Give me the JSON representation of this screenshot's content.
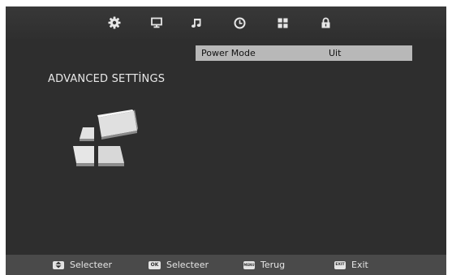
{
  "top_menu": {
    "icons": [
      {
        "name": "settings-gear-icon",
        "active": true
      },
      {
        "name": "monitor-icon",
        "active": false
      },
      {
        "name": "music-note-icon",
        "active": false
      },
      {
        "name": "clock-icon",
        "active": false
      },
      {
        "name": "apps-grid-icon",
        "active": false
      },
      {
        "name": "lock-icon",
        "active": false
      }
    ]
  },
  "section": {
    "title": "ADVANCED SETTİNGS",
    "illustration": "advanced-settings-icon"
  },
  "menu_items": [
    {
      "label": "Power Mode",
      "value": "Uit",
      "selected": true
    }
  ],
  "footer": {
    "hints": [
      {
        "key_icon": "up-down-key-icon",
        "key_text": "",
        "label": "Selecteer"
      },
      {
        "key_icon": "ok-key-icon",
        "key_text": "OK",
        "label": "Selecteer"
      },
      {
        "key_icon": "menu-key-icon",
        "key_text": "MENU",
        "label": "Terug"
      },
      {
        "key_icon": "exit-key-icon",
        "key_text": "EXIT",
        "label": "Exit"
      }
    ]
  },
  "colors": {
    "background": "#2e2e2e",
    "highlight_row": "#b8b8b8",
    "footer_bar": "#4a4a4a",
    "text": "#e8e8e8"
  }
}
